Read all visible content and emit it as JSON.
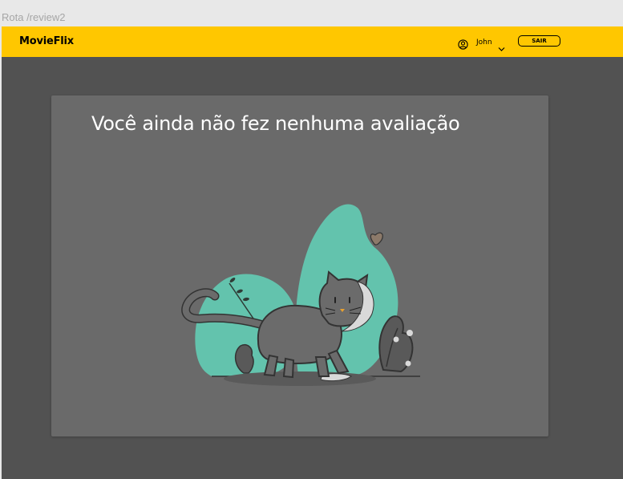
{
  "route": {
    "label": "Rota /review2"
  },
  "navbar": {
    "brand": "MovieFlix",
    "user": {
      "name": "John",
      "icon": "user-circle-icon",
      "dropdown_icon": "chevron-down-icon"
    },
    "logout_label": "SAIR"
  },
  "content": {
    "empty_message": "Você ainda não fez nenhuma avaliação",
    "illustration": "cat-illustration"
  },
  "colors": {
    "navbar": "#ffc700",
    "page_background": "#525252",
    "card_background": "#6a6a6a",
    "illustration_accent": "#63c3ad"
  }
}
